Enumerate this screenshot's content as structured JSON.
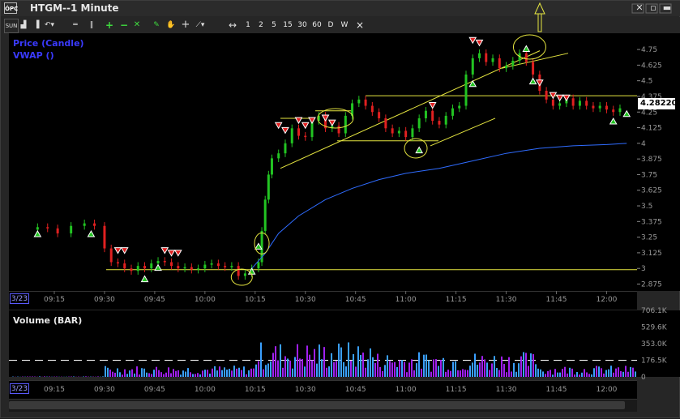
{
  "window": {
    "icon_label": "ÓPC",
    "title": "HTGM--1 Minute"
  },
  "toolbar": {
    "timeframes": [
      "1",
      "2",
      "5",
      "15",
      "30",
      "60",
      "D",
      "W"
    ],
    "close_label": "×"
  },
  "legend": {
    "price": "Price (Candle)",
    "vwap": "VWAP ()",
    "volume": "Volume (BAR)"
  },
  "price_tag": "4.28220",
  "date_label": "3/23",
  "colors": {
    "up": "#22c422",
    "down": "#e02020",
    "vwap": "#2f6cff",
    "trendline": "#e6e640",
    "volume_up": "#3aa0ff",
    "volume_down": "#a020f0",
    "volume_avg": "#ffffff"
  },
  "chart_data": [
    {
      "type": "candlestick",
      "title": "HTGM--1 Minute",
      "yaxis_ticks": [
        "4.75",
        "4.625",
        "4.5",
        "4.375",
        "4.25",
        "4.125",
        "4",
        "3.875",
        "3.75",
        "3.625",
        "3.5",
        "3.375",
        "3.25",
        "3.125",
        "3",
        "2.875"
      ],
      "xaxis_ticks": [
        "09:15",
        "09:30",
        "09:45",
        "10:00",
        "10:15",
        "10:30",
        "10:45",
        "11:00",
        "11:15",
        "11:30",
        "11:45",
        "12:00"
      ],
      "ylim": [
        2.82,
        4.88
      ],
      "last_price": 4.2822,
      "series": [
        {
          "name": "Price (Candle)",
          "points": [
            [
              "09:10",
              3.33
            ],
            [
              "09:13",
              3.32
            ],
            [
              "09:16",
              3.28
            ],
            [
              "09:20",
              3.34
            ],
            [
              "09:24",
              3.36
            ],
            [
              "09:27",
              3.34
            ],
            [
              "09:30",
              3.16
            ],
            [
              "09:32",
              3.05
            ],
            [
              "09:34",
              3.04
            ],
            [
              "09:36",
              3.0
            ],
            [
              "09:38",
              2.98
            ],
            [
              "09:40",
              3.02
            ],
            [
              "09:42",
              3.0
            ],
            [
              "09:44",
              3.04
            ],
            [
              "09:46",
              3.06
            ],
            [
              "09:48",
              3.05
            ],
            [
              "09:50",
              3.02
            ],
            [
              "09:52",
              3.0
            ],
            [
              "09:54",
              3.01
            ],
            [
              "09:56",
              2.99
            ],
            [
              "09:58",
              3.0
            ],
            [
              "10:00",
              3.03
            ],
            [
              "10:02",
              3.04
            ],
            [
              "10:04",
              3.02
            ],
            [
              "10:06",
              3.01
            ],
            [
              "10:08",
              3.02
            ],
            [
              "10:10",
              2.94
            ],
            [
              "10:12",
              2.96
            ],
            [
              "10:14",
              3.0
            ],
            [
              "10:16",
              3.05
            ],
            [
              "10:17",
              3.3
            ],
            [
              "10:18",
              3.55
            ],
            [
              "10:19",
              3.75
            ],
            [
              "10:20",
              3.88
            ],
            [
              "10:22",
              3.92
            ],
            [
              "10:24",
              4.0
            ],
            [
              "10:26",
              4.12
            ],
            [
              "10:28",
              4.06
            ],
            [
              "10:30",
              4.05
            ],
            [
              "10:32",
              4.18
            ],
            [
              "10:34",
              4.22
            ],
            [
              "10:36",
              4.12
            ],
            [
              "10:38",
              4.14
            ],
            [
              "10:40",
              4.08
            ],
            [
              "10:42",
              4.22
            ],
            [
              "10:44",
              4.32
            ],
            [
              "10:46",
              4.35
            ],
            [
              "10:48",
              4.3
            ],
            [
              "10:50",
              4.25
            ],
            [
              "10:52",
              4.2
            ],
            [
              "10:54",
              4.12
            ],
            [
              "10:56",
              4.08
            ],
            [
              "10:58",
              4.1
            ],
            [
              "11:00",
              4.05
            ],
            [
              "11:02",
              4.12
            ],
            [
              "11:04",
              4.2
            ],
            [
              "11:06",
              4.26
            ],
            [
              "11:08",
              4.18
            ],
            [
              "11:10",
              4.15
            ],
            [
              "11:12",
              4.22
            ],
            [
              "11:14",
              4.28
            ],
            [
              "11:16",
              4.3
            ],
            [
              "11:18",
              4.55
            ],
            [
              "11:20",
              4.68
            ],
            [
              "11:22",
              4.72
            ],
            [
              "11:24",
              4.65
            ],
            [
              "11:26",
              4.68
            ],
            [
              "11:28",
              4.6
            ],
            [
              "11:30",
              4.62
            ],
            [
              "11:32",
              4.66
            ],
            [
              "11:34",
              4.72
            ],
            [
              "11:36",
              4.65
            ],
            [
              "11:38",
              4.55
            ],
            [
              "11:40",
              4.42
            ],
            [
              "11:42",
              4.35
            ],
            [
              "11:44",
              4.3
            ],
            [
              "11:46",
              4.32
            ],
            [
              "11:48",
              4.36
            ],
            [
              "11:50",
              4.3
            ],
            [
              "11:52",
              4.34
            ],
            [
              "11:54",
              4.3
            ],
            [
              "11:56",
              4.28
            ],
            [
              "11:58",
              4.3
            ],
            [
              "12:00",
              4.27
            ],
            [
              "12:02",
              4.25
            ],
            [
              "12:04",
              4.28
            ]
          ]
        },
        {
          "name": "VWAP ()",
          "points": [
            [
              "10:14",
              3.0
            ],
            [
              "10:18",
              3.12
            ],
            [
              "10:22",
              3.28
            ],
            [
              "10:28",
              3.42
            ],
            [
              "10:36",
              3.55
            ],
            [
              "10:44",
              3.64
            ],
            [
              "10:52",
              3.71
            ],
            [
              "11:00",
              3.76
            ],
            [
              "11:10",
              3.8
            ],
            [
              "11:20",
              3.86
            ],
            [
              "11:30",
              3.92
            ],
            [
              "11:40",
              3.96
            ],
            [
              "11:50",
              3.98
            ],
            [
              "12:00",
              3.99
            ],
            [
              "12:06",
              4.0
            ]
          ]
        }
      ],
      "annotations": [
        "support 2.99",
        "resistance 4.38",
        "ascending channel",
        "signal markers"
      ]
    },
    {
      "type": "bar",
      "title": "Volume (BAR)",
      "yaxis_ticks": [
        "706.1K",
        "529.6K",
        "353.0K",
        "176.5K",
        "0"
      ],
      "ylim": [
        0,
        706100
      ],
      "average": 176500
    }
  ]
}
